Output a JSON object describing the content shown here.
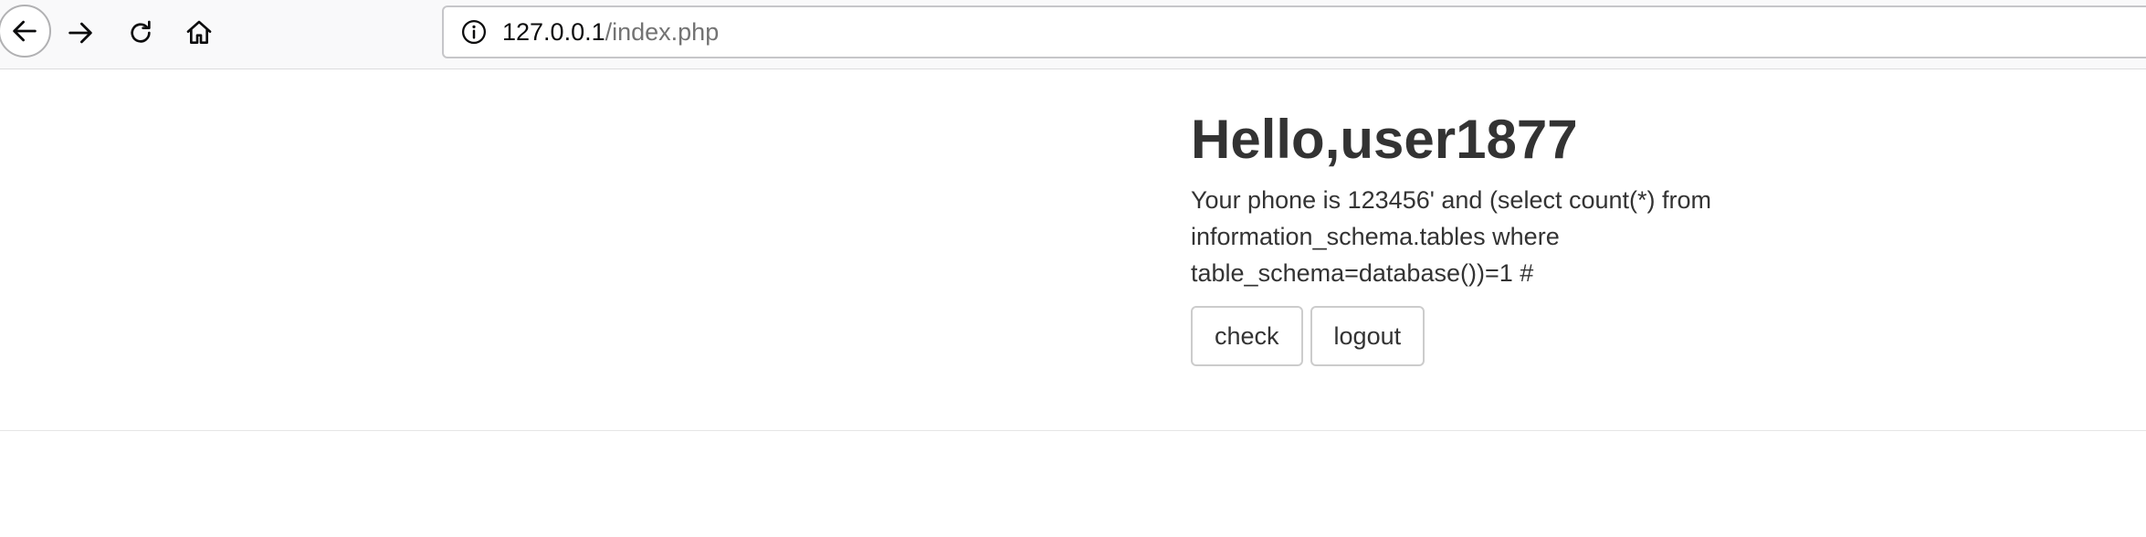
{
  "browser": {
    "url_host": "127.0.0.1",
    "url_path": "/index.php"
  },
  "main": {
    "greeting": "Hello,user1877",
    "phone_text": "Your phone is 123456' and (select count(*) from information_schema.tables where table_schema=database())=1 #",
    "check_label": "check",
    "logout_label": "logout"
  }
}
